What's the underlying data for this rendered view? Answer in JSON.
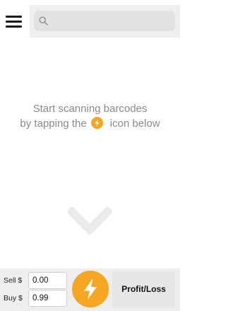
{
  "header": {
    "menu_icon": "hamburger-menu-icon",
    "search": {
      "icon": "search-icon",
      "placeholder": "",
      "value": ""
    }
  },
  "message": {
    "line1": "Start scanning barcodes",
    "line2_before": "by tapping the",
    "line2_icon": "lightning-bolt-icon",
    "line2_after": "icon below"
  },
  "chevron_icon": "chevron-down-icon",
  "bottom_bar": {
    "sell_label": "Sell $",
    "sell_value": "0.00",
    "buy_label": "Buy $",
    "buy_value": "0.99",
    "scan_icon": "lightning-bolt-icon",
    "profit_loss_label": "Profit/Loss"
  },
  "colors": {
    "accent": "#f5a623",
    "message_text": "#8b8b8b",
    "chevron": "#ebebeb",
    "bottom_bar": "#eeeeee"
  }
}
